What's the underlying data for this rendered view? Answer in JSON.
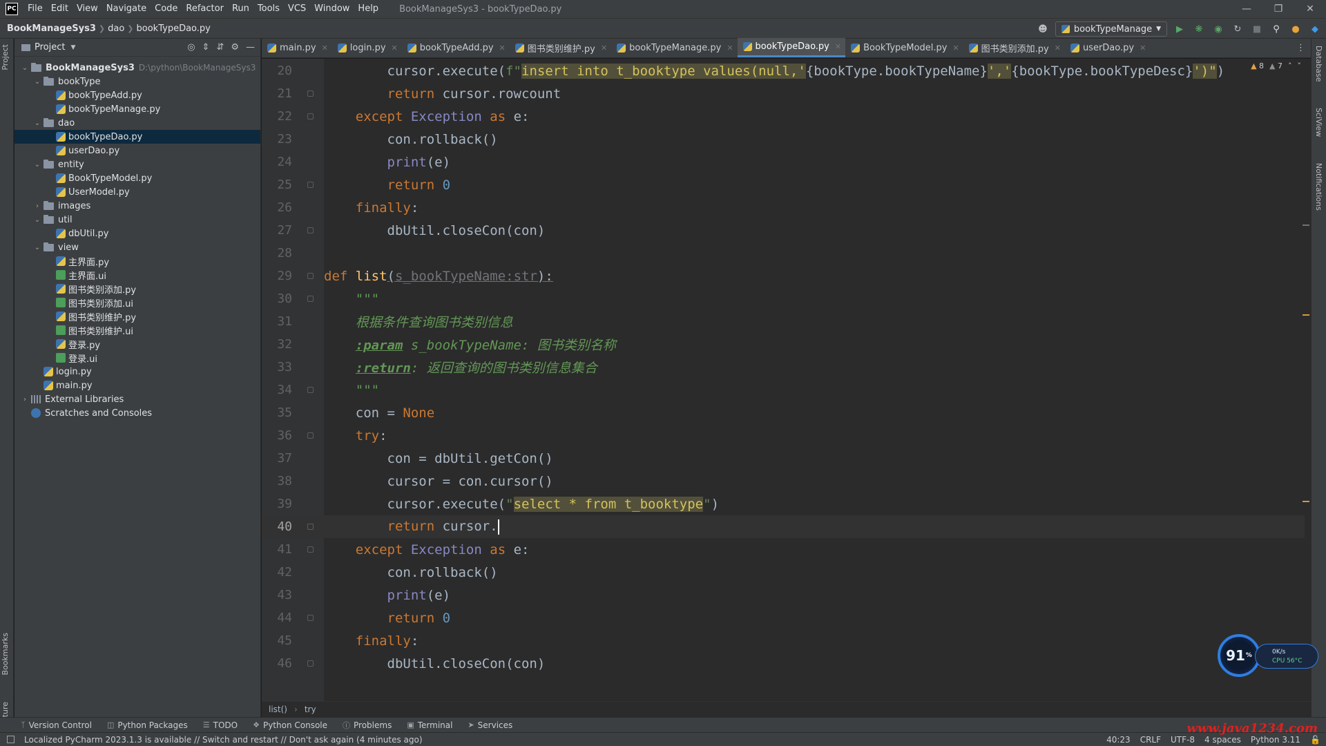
{
  "app": {
    "logo": "PC",
    "window_title": "BookManageSys3 - bookTypeDao.py",
    "menu": [
      "File",
      "Edit",
      "View",
      "Navigate",
      "Code",
      "Refactor",
      "Run",
      "Tools",
      "VCS",
      "Window",
      "Help"
    ]
  },
  "navbar": {
    "project": "BookManageSys3",
    "folder": "dao",
    "file": "bookTypeDao.py",
    "run_config": "bookTypeManage"
  },
  "project_panel": {
    "title": "Project",
    "tree": [
      {
        "label": "BookManageSys3",
        "path": "D:\\python\\BookManageSys3",
        "type": "folder",
        "depth": 0,
        "expanded": true
      },
      {
        "label": "bookType",
        "type": "folder",
        "depth": 1,
        "expanded": true
      },
      {
        "label": "bookTypeAdd.py",
        "type": "py",
        "depth": 2
      },
      {
        "label": "bookTypeManage.py",
        "type": "py",
        "depth": 2
      },
      {
        "label": "dao",
        "type": "folder",
        "depth": 1,
        "expanded": true
      },
      {
        "label": "bookTypeDao.py",
        "type": "py",
        "depth": 2,
        "selected": true
      },
      {
        "label": "userDao.py",
        "type": "py",
        "depth": 2
      },
      {
        "label": "entity",
        "type": "folder",
        "depth": 1,
        "expanded": true
      },
      {
        "label": "BookTypeModel.py",
        "type": "py",
        "depth": 2
      },
      {
        "label": "UserModel.py",
        "type": "py",
        "depth": 2
      },
      {
        "label": "images",
        "type": "folder",
        "depth": 1,
        "expanded": false
      },
      {
        "label": "util",
        "type": "folder",
        "depth": 1,
        "expanded": true
      },
      {
        "label": "dbUtil.py",
        "type": "py",
        "depth": 2
      },
      {
        "label": "view",
        "type": "folder",
        "depth": 1,
        "expanded": true
      },
      {
        "label": "主界面.py",
        "type": "py",
        "depth": 2
      },
      {
        "label": "主界面.ui",
        "type": "ui",
        "depth": 2
      },
      {
        "label": "图书类别添加.py",
        "type": "py",
        "depth": 2
      },
      {
        "label": "图书类别添加.ui",
        "type": "ui",
        "depth": 2
      },
      {
        "label": "图书类别维护.py",
        "type": "py",
        "depth": 2
      },
      {
        "label": "图书类别维护.ui",
        "type": "ui",
        "depth": 2
      },
      {
        "label": "登录.py",
        "type": "py",
        "depth": 2
      },
      {
        "label": "登录.ui",
        "type": "ui",
        "depth": 2
      },
      {
        "label": "login.py",
        "type": "py",
        "depth": 1
      },
      {
        "label": "main.py",
        "type": "py",
        "depth": 1
      },
      {
        "label": "External Libraries",
        "type": "lib",
        "depth": 0,
        "expanded": false
      },
      {
        "label": "Scratches and Consoles",
        "type": "scratch",
        "depth": 0
      }
    ]
  },
  "tabs": [
    {
      "label": "main.py"
    },
    {
      "label": "login.py"
    },
    {
      "label": "bookTypeAdd.py"
    },
    {
      "label": "图书类别维护.py"
    },
    {
      "label": "bookTypeManage.py"
    },
    {
      "label": "bookTypeDao.py",
      "active": true
    },
    {
      "label": "BookTypeModel.py"
    },
    {
      "label": "图书类别添加.py"
    },
    {
      "label": "userDao.py"
    }
  ],
  "editor": {
    "warnings": "8",
    "weak_warnings": "7",
    "current_line": 40,
    "lines": [
      {
        "n": 20,
        "indent": 8,
        "tokens": [
          [
            "cursor.execute(",
            ""
          ],
          [
            "f\"",
            "str"
          ],
          [
            "insert into t_booktype values(null,'",
            "hl"
          ],
          [
            "{bookType.bookTypeName}",
            ""
          ],
          [
            "','",
            "hl"
          ],
          [
            "{bookType.bookTypeDesc}",
            ""
          ],
          [
            "')\"",
            "hl"
          ],
          [
            ")",
            ""
          ]
        ]
      },
      {
        "n": 21,
        "indent": 8,
        "tokens": [
          [
            "return",
            "kw"
          ],
          [
            " cursor.rowcount",
            ""
          ]
        ]
      },
      {
        "n": 22,
        "indent": 4,
        "tokens": [
          [
            "except",
            "kw"
          ],
          [
            " ",
            ""
          ],
          [
            "Exception",
            "bi"
          ],
          [
            " ",
            ""
          ],
          [
            "as",
            "kw"
          ],
          [
            " e:",
            ""
          ]
        ]
      },
      {
        "n": 23,
        "indent": 8,
        "tokens": [
          [
            "con.rollback()",
            ""
          ]
        ]
      },
      {
        "n": 24,
        "indent": 8,
        "tokens": [
          [
            "print",
            "bi"
          ],
          [
            "(e)",
            ""
          ]
        ]
      },
      {
        "n": 25,
        "indent": 8,
        "tokens": [
          [
            "return",
            "kw"
          ],
          [
            " ",
            ""
          ],
          [
            "0",
            "num"
          ]
        ]
      },
      {
        "n": 26,
        "indent": 4,
        "tokens": [
          [
            "finally",
            "kw"
          ],
          [
            ":",
            ""
          ]
        ]
      },
      {
        "n": 27,
        "indent": 8,
        "tokens": [
          [
            "dbUtil.closeCon(con)",
            ""
          ]
        ]
      },
      {
        "n": 28,
        "indent": 0,
        "tokens": []
      },
      {
        "n": 29,
        "indent": 0,
        "tokens": [
          [
            "def",
            "kw"
          ],
          [
            " ",
            ""
          ],
          [
            "list",
            "fn"
          ],
          [
            "(",
            "ul"
          ],
          [
            "s_bookTypeName:str",
            "param ul"
          ],
          [
            "):",
            "ul"
          ]
        ]
      },
      {
        "n": 30,
        "indent": 4,
        "tokens": [
          [
            "\"\"\"",
            "cm"
          ]
        ]
      },
      {
        "n": 31,
        "indent": 4,
        "tokens": [
          [
            "根据条件查询图书类别信息",
            "cm"
          ]
        ]
      },
      {
        "n": 32,
        "indent": 4,
        "tokens": [
          [
            ":param",
            "tag"
          ],
          [
            " s_bookTypeName: 图书类别名称",
            "cm"
          ]
        ]
      },
      {
        "n": 33,
        "indent": 4,
        "tokens": [
          [
            ":return",
            "tag"
          ],
          [
            ": 返回查询的图书类别信息集合",
            "cm"
          ]
        ]
      },
      {
        "n": 34,
        "indent": 4,
        "tokens": [
          [
            "\"\"\"",
            "cm"
          ]
        ]
      },
      {
        "n": 35,
        "indent": 4,
        "tokens": [
          [
            "con = ",
            ""
          ],
          [
            "None",
            "kw"
          ]
        ]
      },
      {
        "n": 36,
        "indent": 4,
        "tokens": [
          [
            "try",
            "kw"
          ],
          [
            ":",
            ""
          ]
        ]
      },
      {
        "n": 37,
        "indent": 8,
        "tokens": [
          [
            "con = dbUtil.getCon()",
            ""
          ]
        ]
      },
      {
        "n": 38,
        "indent": 8,
        "tokens": [
          [
            "cursor = con.cursor()",
            ""
          ]
        ]
      },
      {
        "n": 39,
        "indent": 8,
        "tokens": [
          [
            "cursor.execute(",
            ""
          ],
          [
            "\"",
            "str"
          ],
          [
            "select * from t_booktype",
            "hl"
          ],
          [
            "\"",
            "str"
          ],
          [
            ")",
            ""
          ]
        ]
      },
      {
        "n": 40,
        "indent": 8,
        "tokens": [
          [
            "return",
            "kw"
          ],
          [
            " cursor.",
            ""
          ]
        ],
        "caret": true
      },
      {
        "n": 41,
        "indent": 4,
        "tokens": [
          [
            "except",
            "kw"
          ],
          [
            " ",
            ""
          ],
          [
            "Exception",
            "bi"
          ],
          [
            " ",
            ""
          ],
          [
            "as",
            "kw"
          ],
          [
            " e:",
            ""
          ]
        ]
      },
      {
        "n": 42,
        "indent": 8,
        "tokens": [
          [
            "con.rollback()",
            ""
          ]
        ]
      },
      {
        "n": 43,
        "indent": 8,
        "tokens": [
          [
            "print",
            "bi"
          ],
          [
            "(e)",
            ""
          ]
        ]
      },
      {
        "n": 44,
        "indent": 8,
        "tokens": [
          [
            "return",
            "kw"
          ],
          [
            " ",
            ""
          ],
          [
            "0",
            "num"
          ]
        ]
      },
      {
        "n": 45,
        "indent": 4,
        "tokens": [
          [
            "finally",
            "kw"
          ],
          [
            ":",
            ""
          ]
        ]
      },
      {
        "n": 46,
        "indent": 8,
        "tokens": [
          [
            "dbUtil.closeCon(con)",
            ""
          ]
        ]
      }
    ],
    "breadcrumbs": [
      "list()",
      "try"
    ]
  },
  "left_strip": {
    "top": "Project",
    "bottom1": "Bookmarks",
    "bottom2": "Structure"
  },
  "right_strip": {
    "top": "Database",
    "mid": "SciView",
    "low": "Notifications"
  },
  "bottom_tools": [
    "Version Control",
    "Python Packages",
    "TODO",
    "Python Console",
    "Problems",
    "Terminal",
    "Services"
  ],
  "status": {
    "message": "Localized PyCharm 2023.1.3 is available // Switch and restart // Don't ask again (4 minutes ago)",
    "position": "40:23",
    "line_sep": "CRLF",
    "encoding": "UTF-8",
    "indent": "4 spaces",
    "interpreter": "Python 3.11"
  },
  "perf_widget": {
    "percent": "91",
    "unit": "%",
    "net": "0K/s",
    "cpu": "CPU 56°C"
  },
  "watermark": "www.java1234.com"
}
